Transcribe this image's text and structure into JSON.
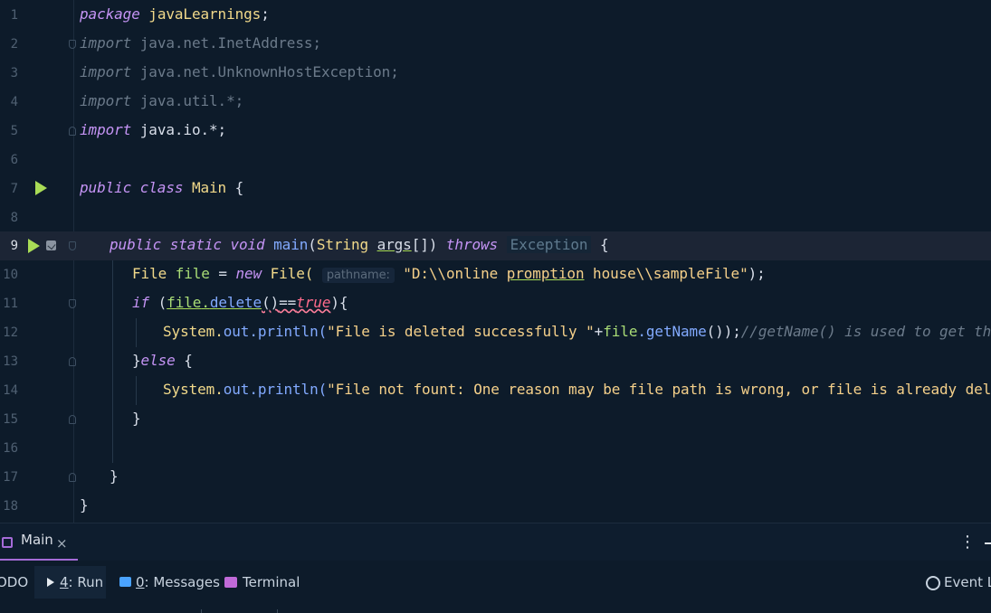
{
  "editor": {
    "line_numbers": [
      "1",
      "2",
      "3",
      "4",
      "5",
      "6",
      "7",
      "8",
      "9",
      "10",
      "11",
      "12",
      "13",
      "14",
      "15",
      "16",
      "17",
      "18"
    ],
    "current_line": "9",
    "line1": {
      "kw": "package",
      "pkg": "javaLearnings",
      "semi": ";"
    },
    "line2": {
      "kw": "import",
      "rest": "java.net.InetAddress;"
    },
    "line3": {
      "kw": "import",
      "rest": "java.net.UnknownHostException;"
    },
    "line4": {
      "kw": "import",
      "rest": "java.util.*;"
    },
    "line5": {
      "kw": "import",
      "rest": "java.io.*;"
    },
    "line7": {
      "kw": "public class",
      "name": "Main",
      "brace": "{"
    },
    "line9": {
      "kw": "public static void",
      "fn": "main",
      "p1": "(",
      "type": "String",
      "arg": "args",
      "p2": "[])",
      "throws": "throws",
      "exc": "Exception",
      "brace": "{"
    },
    "line10": {
      "type": "File",
      "var": "file",
      "eq": "=",
      "new": "new",
      "cls": "File(",
      "hint": "pathname:",
      "str": "\"D:\\\\online ",
      "str_u": "promption",
      "str2": " house\\\\sampleFile\"",
      "end": ");"
    },
    "line11": {
      "kw": "if",
      "p": "(",
      "v": "file",
      "dot": ".",
      "m": "delete",
      "call": "()",
      "op": "==",
      "bool": "true",
      "end": "){"
    },
    "line12": {
      "sys": "System.",
      "out": "out",
      "println": ".println(",
      "str": "\"File is deleted successfully \"",
      "plus": "+",
      "v": "file",
      "m": ".getName",
      "end": "());",
      "comment": "//getName() is used to get the file Name"
    },
    "line13": {
      "brace": "}",
      "kw": "else",
      "rest": " {"
    },
    "line14": {
      "sys": "System.",
      "out": "out",
      "println": ".println(",
      "str": "\"File not fount: One reason may be file path is wrong, or file is already deleted\"",
      "end": ");"
    },
    "line15": {
      "brace": "}"
    },
    "line17": {
      "brace": "}"
    },
    "line18": {
      "brace": "}"
    }
  },
  "tabs": {
    "main_label": "Main",
    "close": "×"
  },
  "toolbar": {
    "todo": "ODO",
    "run_num": "4",
    "run_label": ": Run",
    "msg_num": "0",
    "msg_label": ": Messages",
    "terminal": "Terminal",
    "event": "Event Lo",
    "kebab": "⋮"
  },
  "colors": {
    "background": "#0d1b2a",
    "keyword": "#c594f5",
    "string": "#f5d08a",
    "run_icon": "#a9dc56",
    "accent": "#a56bd8"
  }
}
